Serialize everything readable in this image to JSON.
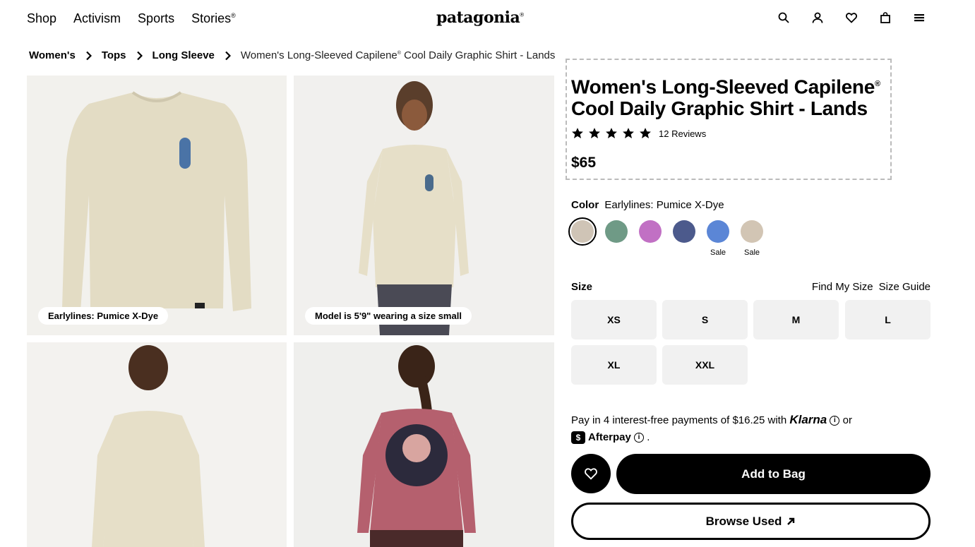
{
  "header": {
    "nav": [
      "Shop",
      "Activism",
      "Sports",
      "Stories"
    ],
    "stories_mark": "®",
    "logo": "patagonia",
    "logo_mark": "®",
    "icons": [
      "search-icon",
      "account-icon",
      "heart-icon",
      "bag-icon",
      "menu-icon"
    ]
  },
  "breadcrumb": {
    "items": [
      "Women's",
      "Tops",
      "Long Sleeve"
    ],
    "current_a": "Women's Long-Sleeved Capilene",
    "current_mark": "®",
    "current_b": " Cool Daily Graphic Shirt - Lands"
  },
  "gallery": {
    "chips": [
      "Earlylines: Pumice X-Dye",
      "Model is 5'9\" wearing a size small"
    ]
  },
  "product": {
    "title_a": "Women's Long-Sleeved Capilene",
    "title_mark": "®",
    "title_b": "Cool Daily Graphic Shirt - Lands",
    "rating": 5,
    "reviews": "12 Reviews",
    "price": "$65"
  },
  "color": {
    "label": "Color",
    "selected": "Earlylines: Pumice X-Dye",
    "swatches": [
      {
        "color": "#cfc4b6",
        "sale": ""
      },
      {
        "color": "#6f9a86",
        "sale": ""
      },
      {
        "color": "#c170c4",
        "sale": ""
      },
      {
        "color": "#4c5a8c",
        "sale": ""
      },
      {
        "color": "#5b86d6",
        "sale": "Sale"
      },
      {
        "color": "#d2c5b4",
        "sale": "Sale"
      }
    ]
  },
  "size": {
    "label": "Size",
    "find": "Find My Size",
    "guide": "Size Guide",
    "options": [
      "XS",
      "S",
      "M",
      "L",
      "XL",
      "XXL"
    ]
  },
  "payment": {
    "text_a": "Pay in 4 interest-free payments of $16.25 with",
    "klarna": "Klarna",
    "or": "or",
    "afterpay": "Afterpay",
    "period": "."
  },
  "actions": {
    "add": "Add to Bag",
    "used": "Browse Used"
  }
}
